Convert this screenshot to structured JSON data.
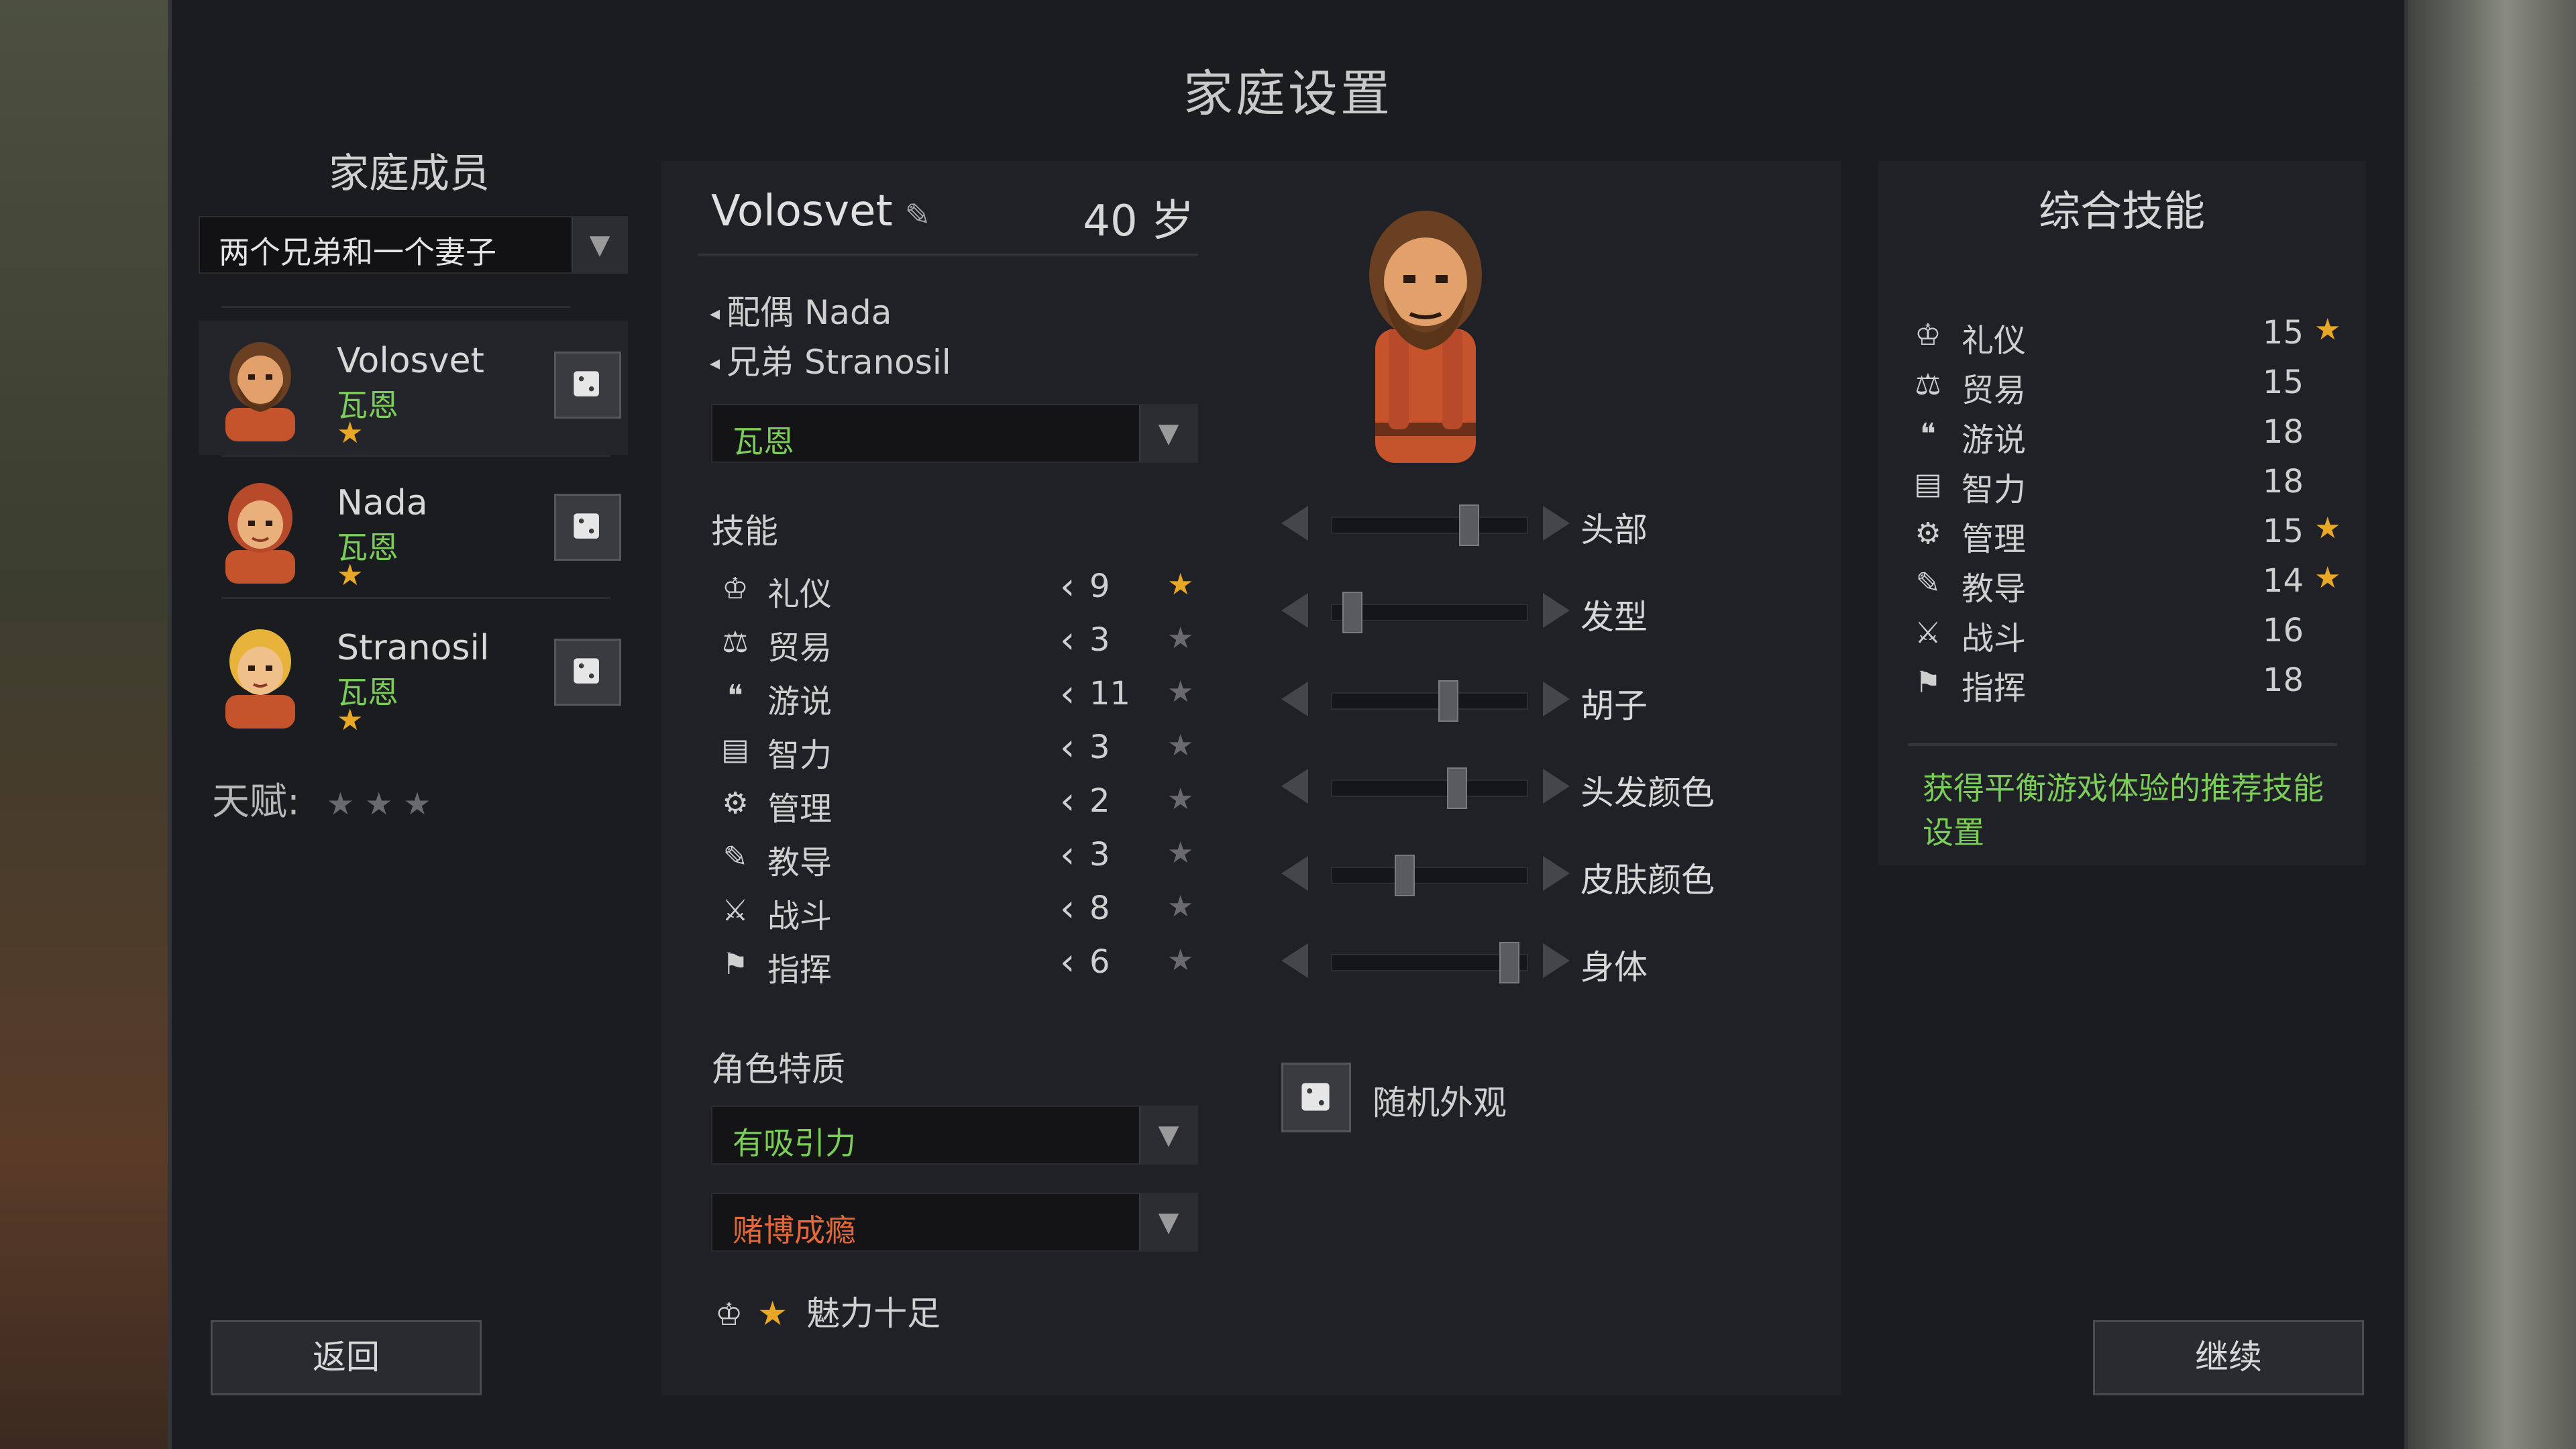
{
  "title": "家庭设置",
  "family": {
    "heading": "家庭成员",
    "preset_value": "两个兄弟和一个妻子",
    "members": [
      {
        "name": "Volosvet",
        "culture": "瓦恩",
        "stars": "★"
      },
      {
        "name": "Nada",
        "culture": "瓦恩",
        "stars": "★"
      },
      {
        "name": "Stranosil",
        "culture": "瓦恩",
        "stars": "★"
      }
    ],
    "talent_label": "天赋:",
    "talent_stars": "★★★"
  },
  "character": {
    "name": "Volosvet",
    "edit_icon": "pencil-icon",
    "age": "40 岁",
    "relations": [
      {
        "label": "配偶 Nada"
      },
      {
        "label": "兄弟 Stranosil"
      }
    ],
    "culture_value": "瓦恩",
    "skills_label": "技能",
    "skills": [
      {
        "icon": "etiquette-icon",
        "label": "礼仪",
        "value": "9",
        "starred": true
      },
      {
        "icon": "trade-icon",
        "label": "贸易",
        "value": "3",
        "starred": false
      },
      {
        "icon": "persuasion-icon",
        "label": "游说",
        "value": "11",
        "starred": false
      },
      {
        "icon": "intellect-icon",
        "label": "智力",
        "value": "3",
        "starred": false
      },
      {
        "icon": "management-icon",
        "label": "管理",
        "value": "2",
        "starred": false
      },
      {
        "icon": "education-icon",
        "label": "教导",
        "value": "3",
        "starred": false
      },
      {
        "icon": "combat-icon",
        "label": "战斗",
        "value": "8",
        "starred": false
      },
      {
        "icon": "command-icon",
        "label": "指挥",
        "value": "6",
        "starred": false
      }
    ],
    "traits_label": "角色特质",
    "trait_positive": "有吸引力",
    "trait_negative": "赌博成瘾",
    "perk_label": "魅力十足"
  },
  "appearance": {
    "sliders": [
      {
        "label": "头部",
        "level": 0.72
      },
      {
        "label": "发型",
        "level": 0.05
      },
      {
        "label": "胡子",
        "level": 0.6
      },
      {
        "label": "头发颜色",
        "level": 0.65
      },
      {
        "label": "皮肤颜色",
        "level": 0.35
      },
      {
        "label": "身体",
        "level": 0.95
      }
    ],
    "random_label": "随机外观"
  },
  "summary": {
    "heading": "综合技能",
    "skills": [
      {
        "icon": "etiquette-icon",
        "label": "礼仪",
        "value": "15",
        "star": "★"
      },
      {
        "icon": "trade-icon",
        "label": "贸易",
        "value": "15",
        "star": ""
      },
      {
        "icon": "persuasion-icon",
        "label": "游说",
        "value": "18",
        "star": ""
      },
      {
        "icon": "intellect-icon",
        "label": "智力",
        "value": "18",
        "star": ""
      },
      {
        "icon": "management-icon",
        "label": "管理",
        "value": "15",
        "star": "★"
      },
      {
        "icon": "education-icon",
        "label": "教导",
        "value": "14",
        "star": "★"
      },
      {
        "icon": "combat-icon",
        "label": "战斗",
        "value": "16",
        "star": ""
      },
      {
        "icon": "command-icon",
        "label": "指挥",
        "value": "18",
        "star": ""
      }
    ],
    "recommend_text": "获得平衡游戏体验的推荐技能设置"
  },
  "buttons": {
    "back": "返回",
    "continue": "继续"
  },
  "colors": {
    "culture_green": "#7ccc5a",
    "trait_positive": "#7ccc5a",
    "trait_negative": "#e0683a",
    "star_gold": "#e8a724"
  }
}
